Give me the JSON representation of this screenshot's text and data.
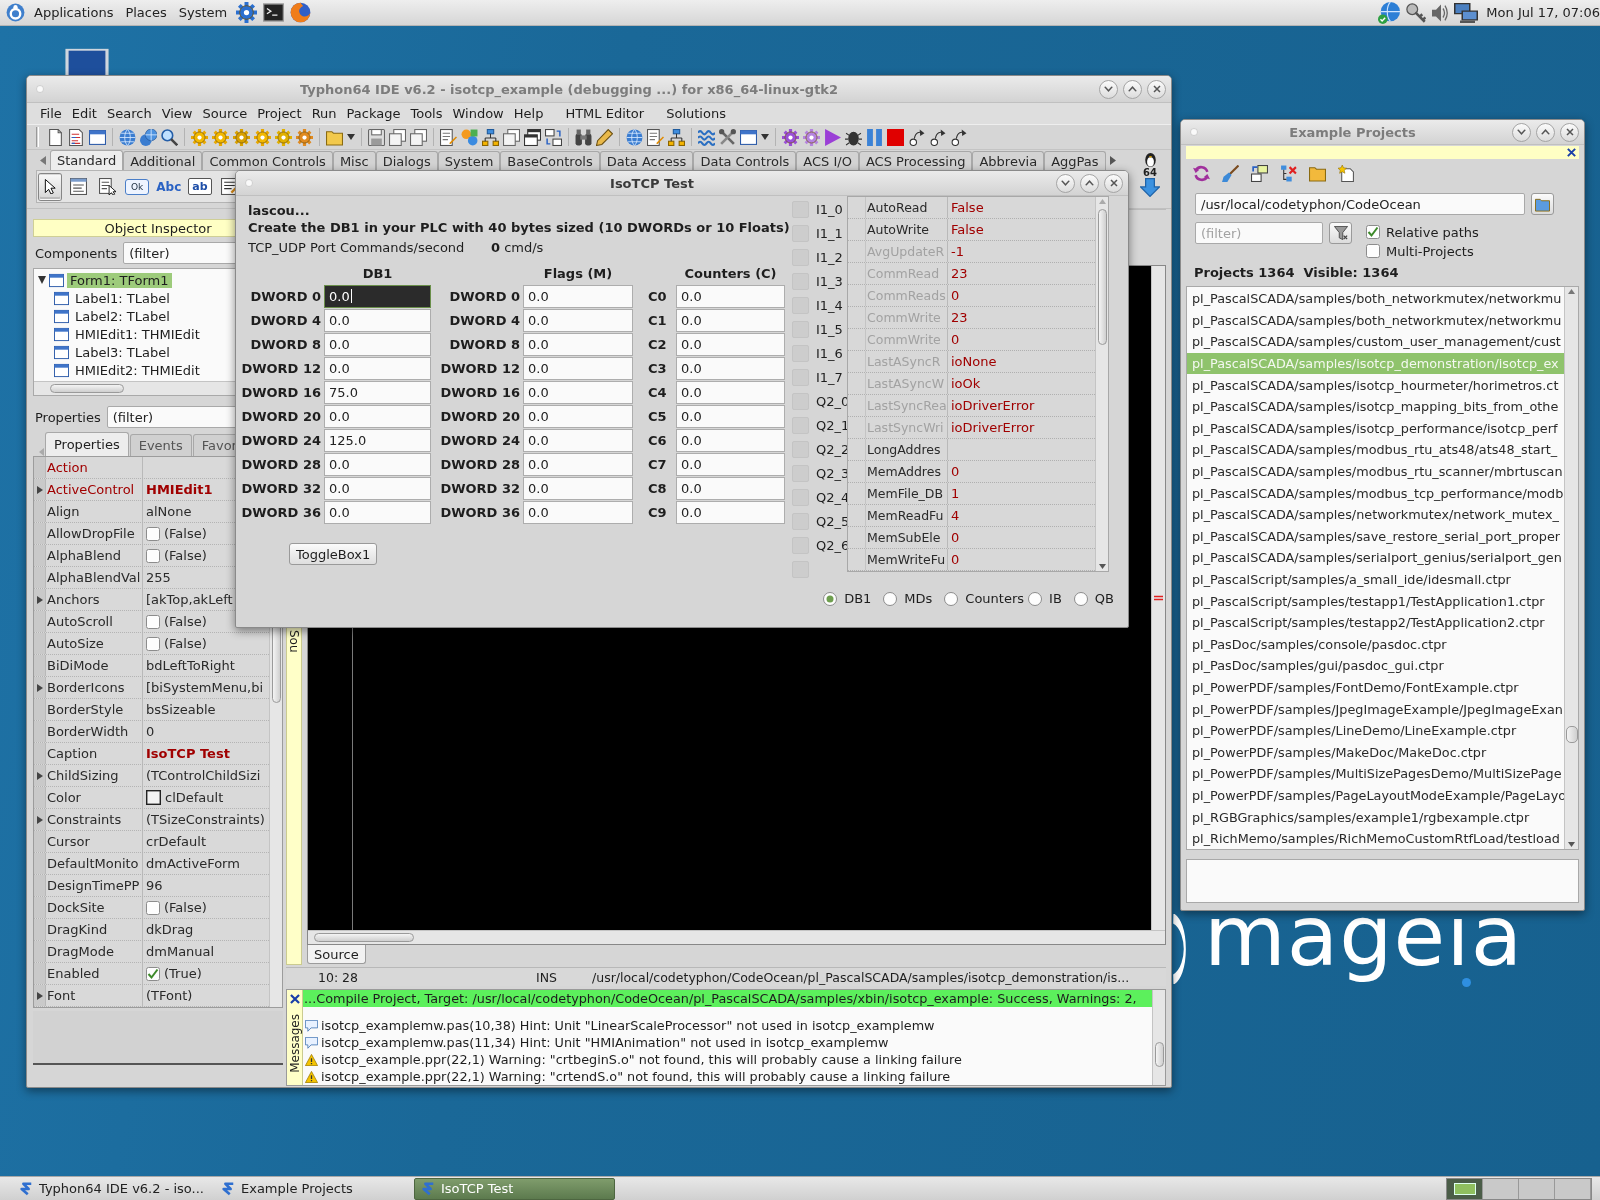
{
  "top_panel": {
    "menus": [
      "Applications",
      "Places",
      "System"
    ],
    "clock": "Mon Jul 17, 07:06"
  },
  "wallpaper": {
    "logo": "mageia"
  },
  "ide": {
    "title": "Typhon64 IDE v6.2 - isotcp_example (debugging ...) for x86_64-linux-gtk2",
    "menu": [
      "File",
      "Edit",
      "Search",
      "View",
      "Source",
      "Project",
      "Run",
      "Package",
      "Tools",
      "Window",
      "Help",
      "HTML Editor",
      "Solutions"
    ],
    "palette": {
      "tabs": [
        {
          "label": "Standard",
          "selected": true
        },
        {
          "label": "Additional",
          "selected": false
        },
        {
          "label": "Common Controls",
          "selected": false
        },
        {
          "label": "Misc",
          "selected": false
        },
        {
          "label": "Dialogs",
          "selected": false
        },
        {
          "label": "System",
          "selected": false
        },
        {
          "label": "BaseControls",
          "selected": false
        },
        {
          "label": "Data Access",
          "selected": false
        },
        {
          "label": "Data Controls",
          "selected": false
        },
        {
          "label": "ACS I/O",
          "selected": false
        },
        {
          "label": "ACS Processing",
          "selected": false
        },
        {
          "label": "Abbrevia",
          "selected": false
        },
        {
          "label": "AggPas",
          "selected": false
        }
      ],
      "tools": [
        {
          "kind": "pointer",
          "selected": true
        },
        {
          "kind": "menu",
          "selected": false
        },
        {
          "kind": "popup",
          "selected": false
        },
        {
          "kind": "button",
          "text": "Ok",
          "selected": false
        },
        {
          "kind": "label",
          "text": "Abc",
          "selected": false
        },
        {
          "kind": "edit",
          "text": "ab",
          "selected": false
        },
        {
          "kind": "memo",
          "selected": false
        }
      ],
      "badge": "64"
    },
    "object_inspector": {
      "title": "Object Inspector",
      "components_label": "Components",
      "components_filter": "(filter)",
      "tree": [
        {
          "label": "Form1: TForm1",
          "selected": true,
          "expanded": true,
          "children": [
            {
              "label": "Label1: TLabel",
              "selected": false
            },
            {
              "label": "Label2: TLabel",
              "selected": false
            },
            {
              "label": "HMIEdit1: THMIEdit",
              "selected": false
            },
            {
              "label": "Label3: TLabel",
              "selected": false
            },
            {
              "label": "HMIEdit2: THMIEdit",
              "selected": false
            }
          ]
        }
      ],
      "properties_label": "Properties",
      "properties_filter": "(filter)",
      "tabs": [
        {
          "label": "Properties",
          "selected": true
        },
        {
          "label": "Events",
          "selected": false
        },
        {
          "label": "Favor",
          "selected": false
        }
      ],
      "properties": [
        {
          "name": "Action",
          "kind": "text",
          "expandable": false,
          "reference": true
        },
        {
          "name": "ActiveControl",
          "value": "HMIEdit1",
          "kind": "text",
          "expandable": true,
          "reference": true,
          "changed": true
        },
        {
          "name": "Align",
          "value": "alNone",
          "kind": "text",
          "expandable": false,
          "reference": false,
          "changed": false
        },
        {
          "name": "AllowDropFile",
          "value": "(False)",
          "kind": "check",
          "checked": false,
          "expandable": false,
          "reference": false,
          "changed": false
        },
        {
          "name": "AlphaBlend",
          "value": "(False)",
          "kind": "check",
          "checked": false,
          "expandable": false,
          "reference": false,
          "changed": false
        },
        {
          "name": "AlphaBlendVal",
          "value": "255",
          "kind": "text",
          "expandable": false,
          "reference": false,
          "changed": false
        },
        {
          "name": "Anchors",
          "value": "[akTop,akLeft",
          "kind": "text",
          "expandable": true,
          "reference": false,
          "changed": false
        },
        {
          "name": "AutoScroll",
          "value": "(False)",
          "kind": "check",
          "checked": false,
          "expandable": false,
          "reference": false,
          "changed": false
        },
        {
          "name": "AutoSize",
          "value": "(False)",
          "kind": "check",
          "checked": false,
          "expandable": false,
          "reference": false,
          "changed": false
        },
        {
          "name": "BiDiMode",
          "value": "bdLeftToRight",
          "kind": "text",
          "expandable": false,
          "reference": false,
          "changed": false
        },
        {
          "name": "BorderIcons",
          "value": "[biSystemMenu,bi",
          "kind": "text",
          "expandable": true,
          "reference": false,
          "changed": false
        },
        {
          "name": "BorderStyle",
          "value": "bsSizeable",
          "kind": "text",
          "expandable": false,
          "reference": false,
          "changed": false
        },
        {
          "name": "BorderWidth",
          "value": "0",
          "kind": "text",
          "expandable": false,
          "reference": false,
          "changed": false
        },
        {
          "name": "Caption",
          "value": "IsoTCP Test",
          "kind": "text",
          "expandable": false,
          "reference": false,
          "changed": true
        },
        {
          "name": "ChildSizing",
          "value": "(TControlChildSizi",
          "kind": "text",
          "expandable": true,
          "reference": false,
          "changed": false
        },
        {
          "name": "Color",
          "value": "clDefault",
          "kind": "color",
          "expandable": false,
          "reference": false,
          "changed": false
        },
        {
          "name": "Constraints",
          "value": "(TSizeConstraints)",
          "kind": "text",
          "expandable": true,
          "reference": false,
          "changed": false
        },
        {
          "name": "Cursor",
          "value": "crDefault",
          "kind": "text",
          "expandable": false,
          "reference": false,
          "changed": false
        },
        {
          "name": "DefaultMonito",
          "value": "dmActiveForm",
          "kind": "text",
          "expandable": false,
          "reference": false,
          "changed": false
        },
        {
          "name": "DesignTimePP",
          "value": "96",
          "kind": "text",
          "expandable": false,
          "reference": false,
          "changed": false
        },
        {
          "name": "DockSite",
          "value": "(False)",
          "kind": "check",
          "checked": false,
          "expandable": false,
          "reference": false,
          "changed": false
        },
        {
          "name": "DragKind",
          "value": "dkDrag",
          "kind": "text",
          "expandable": false,
          "reference": false,
          "changed": false
        },
        {
          "name": "DragMode",
          "value": "dmManual",
          "kind": "text",
          "expandable": false,
          "reference": false,
          "changed": false
        },
        {
          "name": "Enabled",
          "value": "(True)",
          "kind": "check",
          "checked": true,
          "expandable": false,
          "reference": false,
          "changed": false
        },
        {
          "name": "Font",
          "value": "(TFont)",
          "kind": "text",
          "expandable": true,
          "reference": false,
          "changed": false
        }
      ]
    },
    "editor": {
      "side_tab": "Sou",
      "tab": "Source"
    },
    "status_bar": {
      "position": "10: 28",
      "mode": "INS",
      "file": "/usr/local/codetyphon/CodeOcean/pl_PascalSCADA/samples/isotcp_demonstration/is..."
    },
    "messages": {
      "label": "Messages",
      "items": [
        {
          "kind": "success",
          "text": "...Compile Project, Target: /usr/local/codetyphon/CodeOcean/pl_PascalSCADA/samples/xbin/isotcp_example: Success, Warnings: 2,"
        },
        {
          "kind": "hint",
          "text": "isotcp_examplemw.pas(10,38) Hint: Unit \"LinearScaleProcessor\" not used in isotcp_examplemw"
        },
        {
          "kind": "hint",
          "text": "isotcp_examplemw.pas(11,34) Hint: Unit \"HMIAnimation\" not used in isotcp_examplemw"
        },
        {
          "kind": "warning",
          "text": "isotcp_example.ppr(22,1) Warning: \"crtbeginS.o\" not found, this will probably cause a linking failure"
        },
        {
          "kind": "warning",
          "text": "isotcp_example.ppr(22,1) Warning: \"crtendS.o\" not found, this will probably cause a linking failure"
        }
      ]
    }
  },
  "isotcp_dialog": {
    "title": "IsoTCP Test",
    "user": "lascou...",
    "instruction": "Create the DB1 in your PLC with 40 bytes sized (10 DWORDs or 10 Floats)",
    "rate_label": "TCP_UDP Port Commands/second",
    "rate": "**0** cmd/s",
    "columns": [
      {
        "title": "DB1",
        "rows": [
          {
            "label": "DWORD 0",
            "value": "0.0",
            "focused": true
          },
          {
            "label": "DWORD 4",
            "value": "0.0",
            "focused": false
          },
          {
            "label": "DWORD 8",
            "value": "0.0",
            "focused": false
          },
          {
            "label": "DWORD 12",
            "value": "0.0",
            "focused": false
          },
          {
            "label": "DWORD 16",
            "value": "75.0",
            "focused": false
          },
          {
            "label": "DWORD 20",
            "value": "0.0",
            "focused": false
          },
          {
            "label": "DWORD 24",
            "value": "125.0",
            "focused": false
          },
          {
            "label": "DWORD 28",
            "value": "0.0",
            "focused": false
          },
          {
            "label": "DWORD 32",
            "value": "0.0",
            "focused": false
          },
          {
            "label": "DWORD 36",
            "value": "0.0",
            "focused": false
          }
        ]
      },
      {
        "title": "Flags (M)",
        "rows": [
          {
            "label": "DWORD 0",
            "value": "0.0",
            "focused": false
          },
          {
            "label": "DWORD 4",
            "value": "0.0",
            "focused": false
          },
          {
            "label": "DWORD 8",
            "value": "0.0",
            "focused": false
          },
          {
            "label": "DWORD 12",
            "value": "0.0",
            "focused": false
          },
          {
            "label": "DWORD 16",
            "value": "0.0",
            "focused": false
          },
          {
            "label": "DWORD 20",
            "value": "0.0",
            "focused": false
          },
          {
            "label": "DWORD 24",
            "value": "0.0",
            "focused": false
          },
          {
            "label": "DWORD 28",
            "value": "0.0",
            "focused": false
          },
          {
            "label": "DWORD 32",
            "value": "0.0",
            "focused": false
          },
          {
            "label": "DWORD 36",
            "value": "0.0",
            "focused": false
          }
        ]
      },
      {
        "title": "Counters (C)",
        "rows": [
          {
            "label": "C0",
            "value": "0.0",
            "focused": false
          },
          {
            "label": "C1",
            "value": "0.0",
            "focused": false
          },
          {
            "label": "C2",
            "value": "0.0",
            "focused": false
          },
          {
            "label": "C3",
            "value": "0.0",
            "focused": false
          },
          {
            "label": "C4",
            "value": "0.0",
            "focused": false
          },
          {
            "label": "C5",
            "value": "0.0",
            "focused": false
          },
          {
            "label": "C6",
            "value": "0.0",
            "focused": false
          },
          {
            "label": "C7",
            "value": "0.0",
            "focused": false
          },
          {
            "label": "C8",
            "value": "0.0",
            "focused": false
          },
          {
            "label": "C9",
            "value": "0.0",
            "focused": false
          }
        ]
      }
    ],
    "toggle_button": "ToggleBox1",
    "bits": [
      {
        "label": "I1_0",
        "on": false
      },
      {
        "label": "I1_1",
        "on": false
      },
      {
        "label": "I1_2",
        "on": false
      },
      {
        "label": "I1_3",
        "on": false
      },
      {
        "label": "I1_4",
        "on": false
      },
      {
        "label": "I1_5",
        "on": false
      },
      {
        "label": "I1_6",
        "on": false
      },
      {
        "label": "I1_7",
        "on": false
      },
      {
        "label": "Q2_0",
        "on": false
      },
      {
        "label": "Q2_1",
        "on": false
      },
      {
        "label": "Q2_2",
        "on": false
      },
      {
        "label": "Q2_3",
        "on": false
      },
      {
        "label": "Q2_4",
        "on": false
      },
      {
        "label": "Q2_5",
        "on": false
      },
      {
        "label": "Q2_6",
        "on": false
      },
      {
        "on": false
      }
    ],
    "tag_properties": [
      {
        "name": "AutoRead",
        "value": "False",
        "readonly": false
      },
      {
        "name": "AutoWrite",
        "value": "False",
        "readonly": false
      },
      {
        "name": "AvgUpdateR",
        "value": "-1",
        "readonly": true
      },
      {
        "name": "CommRead",
        "value": "23",
        "readonly": true
      },
      {
        "name": "CommReads",
        "value": "0",
        "readonly": true
      },
      {
        "name": "CommWrite",
        "value": "23",
        "readonly": true
      },
      {
        "name": "CommWrite",
        "value": "0",
        "readonly": true
      },
      {
        "name": "LastASyncR",
        "value": "ioNone",
        "readonly": true
      },
      {
        "name": "LastASyncW",
        "value": "ioOk",
        "readonly": true
      },
      {
        "name": "LastSyncRea",
        "value": "ioDriverError",
        "readonly": true
      },
      {
        "name": "LastSyncWri",
        "value": "ioDriverError",
        "readonly": true
      },
      {
        "name": "LongAddres",
        "readonly": false
      },
      {
        "name": "MemAddres",
        "value": "0",
        "readonly": false
      },
      {
        "name": "MemFile_DB",
        "value": "1",
        "readonly": false
      },
      {
        "name": "MemReadFu",
        "value": "4",
        "readonly": false
      },
      {
        "name": "MemSubEle",
        "value": "0",
        "readonly": false
      },
      {
        "name": "MemWriteFu",
        "value": "0",
        "readonly": false
      }
    ],
    "radios": [
      {
        "label": "DB1",
        "selected": true
      },
      {
        "label": "MDs",
        "selected": false
      },
      {
        "label": "Counters",
        "selected": false
      },
      {
        "label": "IB",
        "selected": false
      },
      {
        "label": "QB",
        "selected": false
      }
    ]
  },
  "example_projects": {
    "title": "Example Projects",
    "path": "/usr/local/codetyphon/CodeOcean",
    "filter_placeholder": "(filter)",
    "options": [
      {
        "label": "Relative paths",
        "checked": true
      },
      {
        "label": "Multi-Projects",
        "checked": false
      }
    ],
    "count": "Projects 1364",
    "visible": "Visible: 1364",
    "projects": [
      {
        "path": "pl_PascalSCADA/samples/both_networkmutex/networkmu",
        "selected": false
      },
      {
        "path": "pl_PascalSCADA/samples/both_networkmutex/networkmu",
        "selected": false
      },
      {
        "path": "pl_PascalSCADA/samples/custom_user_management/cust",
        "selected": false
      },
      {
        "path": "pl_PascalSCADA/samples/isotcp_demonstration/isotcp_ex",
        "selected": true
      },
      {
        "path": "pl_PascalSCADA/samples/isotcp_hourmeter/horimetros.ct",
        "selected": false
      },
      {
        "path": "pl_PascalSCADA/samples/isotcp_mapping_bits_from_othe",
        "selected": false
      },
      {
        "path": "pl_PascalSCADA/samples/isotcp_performance/isotcp_perf",
        "selected": false
      },
      {
        "path": "pl_PascalSCADA/samples/modbus_rtu_ats48/ats48_start_",
        "selected": false
      },
      {
        "path": "pl_PascalSCADA/samples/modbus_rtu_scanner/mbrtuscan",
        "selected": false
      },
      {
        "path": "pl_PascalSCADA/samples/modbus_tcp_performance/modb",
        "selected": false
      },
      {
        "path": "pl_PascalSCADA/samples/networkmutex/network_mutex_",
        "selected": false
      },
      {
        "path": "pl_PascalSCADA/samples/save_restore_serial_port_proper",
        "selected": false
      },
      {
        "path": "pl_PascalSCADA/samples/serialport_genius/serialport_gen",
        "selected": false
      },
      {
        "path": "pl_PascalScript/samples/a_small_ide/idesmall.ctpr",
        "selected": false
      },
      {
        "path": "pl_PascalScript/samples/testapp1/TestApplication1.ctpr",
        "selected": false
      },
      {
        "path": "pl_PascalScript/samples/testapp2/TestApplication2.ctpr",
        "selected": false
      },
      {
        "path": "pl_PasDoc/samples/console/pasdoc.ctpr",
        "selected": false
      },
      {
        "path": "pl_PasDoc/samples/gui/pasdoc_gui.ctpr",
        "selected": false
      },
      {
        "path": "pl_PowerPDF/samples/FontDemo/FontExample.ctpr",
        "selected": false
      },
      {
        "path": "pl_PowerPDF/samples/JpegImageExample/JpegImageExan",
        "selected": false
      },
      {
        "path": "pl_PowerPDF/samples/LineDemo/LineExample.ctpr",
        "selected": false
      },
      {
        "path": "pl_PowerPDF/samples/MakeDoc/MakeDoc.ctpr",
        "selected": false
      },
      {
        "path": "pl_PowerPDF/samples/MultiSizePagesDemo/MultiSizePage",
        "selected": false
      },
      {
        "path": "pl_PowerPDF/samples/PageLayoutModeExample/PageLayo",
        "selected": false
      },
      {
        "path": "pl_RGBGraphics/samples/example1/rgbexample.ctpr",
        "selected": false
      },
      {
        "path": "pl_RichMemo/samples/RichMemoCustomRtfLoad/testload",
        "selected": false
      }
    ]
  },
  "taskbar": [
    {
      "label": "Typhon64 IDE v6.2 - iso...",
      "selected": false
    },
    {
      "label": "Example Projects",
      "selected": false
    },
    {
      "label": "IsoTCP Test",
      "selected": true
    }
  ]
}
